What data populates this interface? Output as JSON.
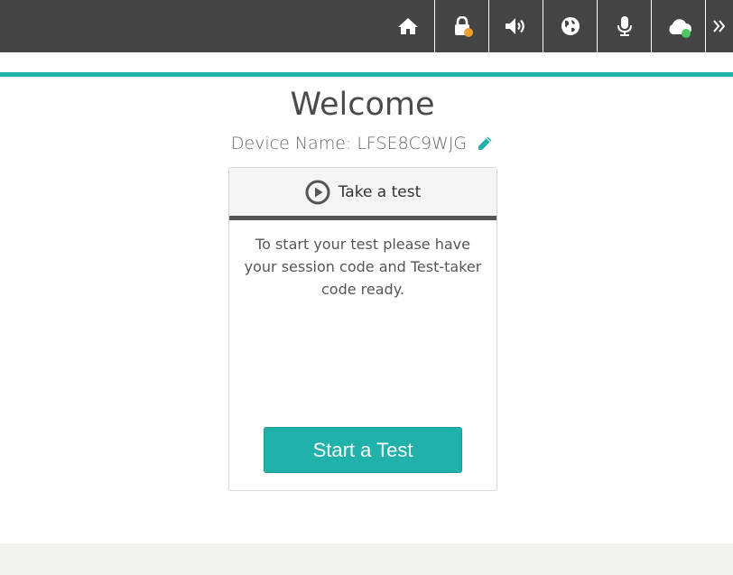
{
  "colors": {
    "topbar_bg": "#444444",
    "accent": "#20b2aa",
    "button_bg": "#20b2aa",
    "lock_status": "#f0a030",
    "cloud_status": "#4cc860",
    "footer_bg": "#f2f2f0"
  },
  "toolbar": {
    "items": [
      {
        "name": "home",
        "icon": "home-icon"
      },
      {
        "name": "lock",
        "icon": "lock-icon",
        "status": "warning"
      },
      {
        "name": "volume",
        "icon": "volume-icon"
      },
      {
        "name": "language",
        "icon": "globe-icon"
      },
      {
        "name": "microphone",
        "icon": "microphone-icon"
      },
      {
        "name": "cloud",
        "icon": "cloud-icon",
        "status": "connected"
      },
      {
        "name": "more",
        "icon": "double-chevron-right-icon"
      }
    ]
  },
  "main": {
    "title": "Welcome",
    "device_label": "Device Name: ",
    "device_name": "LFSE8C9WJG",
    "edit_icon": "pencil-icon"
  },
  "card": {
    "header_icon": "play-circle-icon",
    "header_title": "Take a test",
    "description": "To start your test please have your session code and Test-taker code ready.",
    "button_label": "Start a Test"
  }
}
